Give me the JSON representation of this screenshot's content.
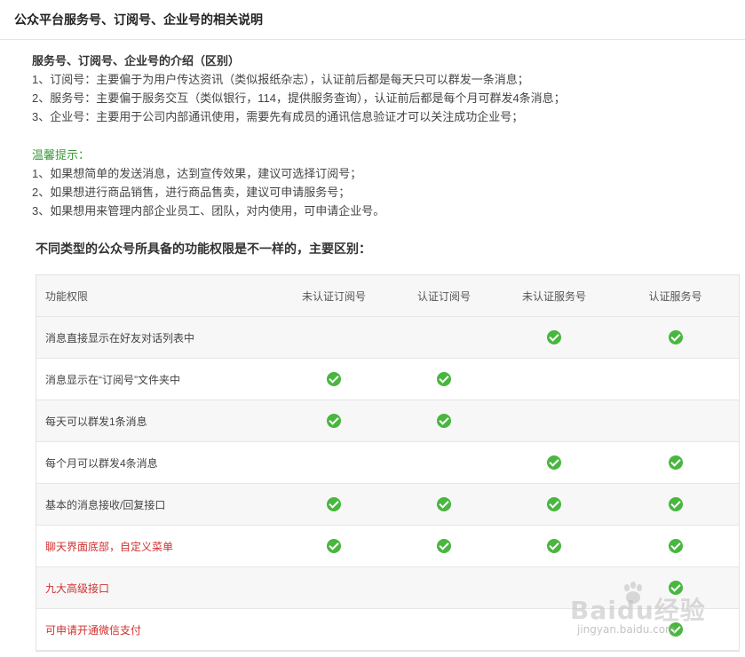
{
  "page": {
    "title": "公众平台服务号、订阅号、企业号的相关说明"
  },
  "intro": {
    "heading": "服务号、订阅号、企业号的介绍（区别）",
    "lines": [
      "1、订阅号：主要偏于为用户传达资讯（类似报纸杂志），认证前后都是每天只可以群发一条消息；",
      "2、服务号：主要偏于服务交互（类似银行，114，提供服务查询），认证前后都是每个月可群发4条消息；",
      "3、企业号：主要用于公司内部通讯使用，需要先有成员的通讯信息验证才可以关注成功企业号；"
    ]
  },
  "tips": {
    "title": "温馨提示：",
    "lines": [
      "1、如果想简单的发送消息，达到宣传效果，建议可选择订阅号；",
      "2、如果想进行商品销售，进行商品售卖，建议可申请服务号；",
      "3、如果想用来管理内部企业员工、团队，对内使用，可申请企业号。"
    ]
  },
  "comparison": {
    "subtitle": "不同类型的公众号所具备的功能权限是不一样的，主要区别：",
    "headers": [
      "功能权限",
      "未认证订阅号",
      "认证订阅号",
      "未认证服务号",
      "认证服务号"
    ],
    "rows": [
      {
        "feature": "消息直接显示在好友对话列表中",
        "highlight": false,
        "checks": [
          false,
          false,
          true,
          true
        ]
      },
      {
        "feature": "消息显示在“订阅号”文件夹中",
        "highlight": false,
        "checks": [
          true,
          true,
          false,
          false
        ]
      },
      {
        "feature": "每天可以群发1条消息",
        "highlight": false,
        "checks": [
          true,
          true,
          false,
          false
        ]
      },
      {
        "feature": "每个月可以群发4条消息",
        "highlight": false,
        "checks": [
          false,
          false,
          true,
          true
        ]
      },
      {
        "feature": "基本的消息接收/回复接口",
        "highlight": false,
        "checks": [
          true,
          true,
          true,
          true
        ]
      },
      {
        "feature": "聊天界面底部，自定义菜单",
        "highlight": true,
        "checks": [
          true,
          true,
          true,
          true
        ]
      },
      {
        "feature": "九大高级接口",
        "highlight": true,
        "checks": [
          false,
          false,
          false,
          true
        ]
      },
      {
        "feature": "可申请开通微信支付",
        "highlight": true,
        "checks": [
          false,
          false,
          false,
          true
        ]
      }
    ]
  },
  "colors": {
    "check": "#49b63f",
    "highlight_text": "#d03030",
    "tips_title": "#3b9a3b"
  },
  "watermark": {
    "brand": "Baidu经验",
    "url": "jingyan.baidu.com"
  }
}
